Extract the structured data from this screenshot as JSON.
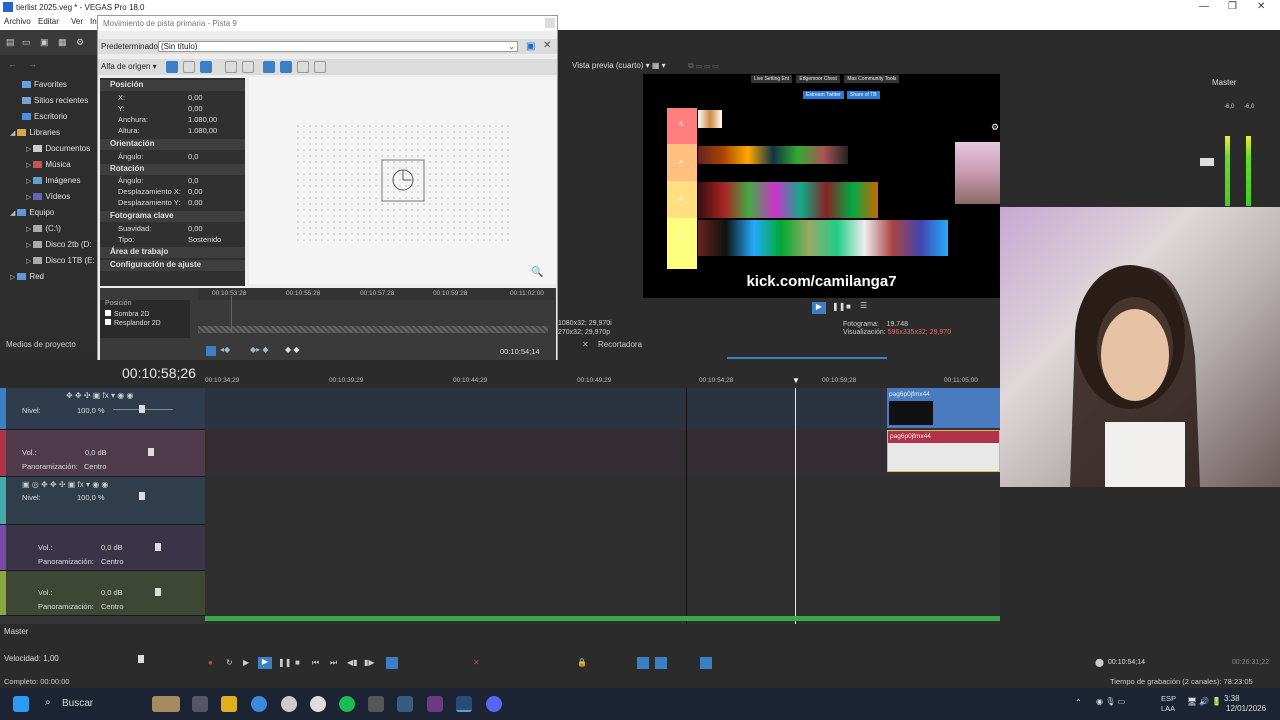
{
  "window": {
    "title": "tierlist 2025.veg * - VEGAS Pro 18.0"
  },
  "menu": {
    "items": [
      "Archivo",
      "Editar",
      "Ver",
      "In"
    ]
  },
  "explorer": {
    "items": [
      "Favorites",
      "Sitios recientes",
      "Escritorio",
      "Libraries",
      "Documentos",
      "Música",
      "Imágenes",
      "Vídeos",
      "Equipo",
      "(C:\\)",
      "Disco 2tb (D:",
      "Disco 1TB (E:",
      "Red"
    ],
    "tab": "Medios de proyecto"
  },
  "track_motion": {
    "title": "Movimiento de pista primaria - Pista 9",
    "preset_label": "Predeterminado:",
    "preset_value": "(Sin título)",
    "alpha_label": "Alfa de origen",
    "sections": {
      "position": "Posición",
      "orientation": "Orientación",
      "rotation": "Rotación",
      "keyframe": "Fotograma clave",
      "work_area": "Área de trabajo",
      "settings": "Configuración de ajuste"
    },
    "props": {
      "x_label": "X:",
      "x": "0,00",
      "y_label": "Y:",
      "y": "0,00",
      "width_label": "Anchura:",
      "width": "1.080,00",
      "height_label": "Altura:",
      "height": "1.080,00",
      "angle_label": "Ángulo:",
      "angle": "0,0",
      "rot_angle_label": "Ángulo:",
      "rot_angle": "0,0",
      "offx_label": "Desplazamiento X:",
      "offx": "0,00",
      "offy_label": "Desplazamiento Y:",
      "offy": "0,00",
      "smooth_label": "Suavidad:",
      "smooth": "0,00",
      "type_label": "Tipo:",
      "type": "Sostenido"
    },
    "timeline_labels": [
      "Posición",
      "Sombra 2D",
      "Resplandor 2D"
    ],
    "ruler": [
      "00:10:53:28",
      "00:10:55:28",
      "00:10:57:28",
      "00:10:59:28",
      "00:11:02:00"
    ],
    "timecode": "00:10:54;14"
  },
  "preview": {
    "mode": "Vista previa (cuarto)",
    "kick_text": "kick.com/camilanga7",
    "top_tabs": [
      "Live Setting Ent",
      "Edgemoor Chest",
      "Mas Community Tools"
    ],
    "buttons": [
      "Estream Twitter",
      "Share of TB"
    ],
    "project_info": "1080x32; 29,970i",
    "preview_info": "270x32; 29,970p",
    "frame_label": "Fotograma:",
    "frame": "19.748",
    "display_label": "Visualización:",
    "display": "596x335x32; 29,970",
    "trimmer_tab": "Recortadora",
    "tiers": [
      {
        "label": "S",
        "color": "#ff7f7f"
      },
      {
        "label": "A",
        "color": "#ffbf7f"
      },
      {
        "label": "B",
        "color": "#ffdf7f"
      },
      {
        "label": "C",
        "color": "#ffff7f"
      }
    ]
  },
  "mixer": {
    "title": "Master",
    "left_db": "-6,0",
    "right_db": "-6,0"
  },
  "timeline": {
    "current_time": "00:10:58;26",
    "ruler": [
      "00:10:34;29",
      "00:10:39;29",
      "00:10:44;29",
      "00:10:49;29",
      "00:10:54;28",
      "00:10:59;28",
      "00:11:05;00"
    ],
    "tracks": [
      {
        "label": "Nivel:",
        "value": "100,0 %",
        "color": "#3b7fc4"
      },
      {
        "label": "Vol.:",
        "value": "0,0 dB",
        "pan_label": "Panoramización:",
        "pan": "Centro",
        "color": "#b0334a"
      },
      {
        "label": "Nivel:",
        "value": "100,0 %",
        "color": "#44aaaa"
      },
      {
        "label": "Vol.:",
        "value": "0,0 dB",
        "pan_label": "Panoramización:",
        "pan": "Centro",
        "color": "#7a4aa8"
      },
      {
        "label": "Vol.:",
        "value": "0,0 dB",
        "pan_label": "Panoramización:",
        "pan": "Centro",
        "color": "#8aa840"
      }
    ],
    "clip_name": "pag6p0jfmx44",
    "clip_name_audio": "pag6p0jfmx44",
    "master_label": "Master",
    "speed_label": "Velocidad: 1,00",
    "end_timecode": "00:10:54;14",
    "length_timecode": "00:26:31;22"
  },
  "status": {
    "left": "Completo: 00:00:00",
    "right": "Tiempo de grabación (2 canales): 78:23:05"
  },
  "taskbar": {
    "search": "Buscar",
    "lang1": "ESP",
    "lang2": "LAA",
    "time": "3:38",
    "date": "12/01/2026"
  }
}
